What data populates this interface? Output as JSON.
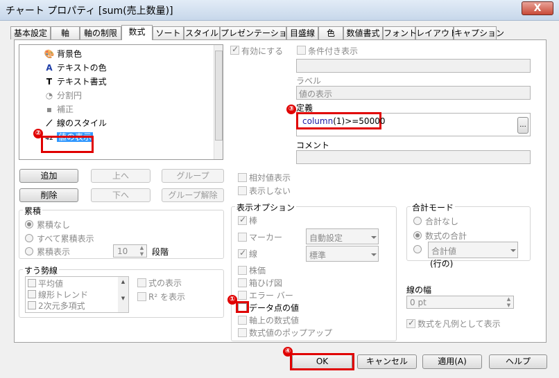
{
  "window": {
    "title": "チャート プロパティ [sum(売上数量)]",
    "close": "X"
  },
  "tabs": [
    "基本設定",
    "軸",
    "軸の制限",
    "数式",
    "ソート",
    "スタイル",
    "プレゼンテーション",
    "目盛線",
    "色",
    "数値書式",
    "フォント",
    "レイアウト",
    "キャプション"
  ],
  "active_tab": "数式",
  "expression_list": [
    {
      "label": "背景色",
      "icon": "palette-icon"
    },
    {
      "label": "テキストの色",
      "icon": "text-color-icon"
    },
    {
      "label": "テキスト書式",
      "icon": "text-format-icon"
    },
    {
      "label": "分割円",
      "icon": "pie-icon"
    },
    {
      "label": "補正",
      "icon": "adjust-icon"
    },
    {
      "label": "線のスタイル",
      "icon": "line-style-icon"
    },
    {
      "label": "値の表示",
      "icon": "value-display-icon"
    }
  ],
  "list_buttons": {
    "add": "追加",
    "up": "上へ",
    "group": "グループ",
    "delete": "削除",
    "down": "下へ",
    "ungroup": "グループ解除"
  },
  "accumulation": {
    "legend": "累積",
    "none": "累積なし",
    "all": "すべて累積表示",
    "show": "累積表示",
    "steps_value": "10",
    "steps_label": "段階"
  },
  "trendlines": {
    "legend": "すう勢線",
    "items": [
      "平均値",
      "線形トレンド",
      "2次元多項式"
    ],
    "show_equation": "式の表示",
    "show_r2": "R² を表示"
  },
  "enable": "有効にする",
  "conditional": "条件付き表示",
  "label": {
    "caption": "ラベル",
    "value": "値の表示"
  },
  "definition": {
    "caption": "定義",
    "fn": "column",
    "arg": "(1)",
    "rest": ">=50000",
    "browse": "..."
  },
  "comment": {
    "caption": "コメント"
  },
  "relative": "相対値表示",
  "invisible": "表示しない",
  "display_options": {
    "legend": "表示オプション",
    "bar": "棒",
    "marker": "マーカー",
    "marker_value": "自動設定",
    "line": "線",
    "line_value": "標準",
    "stock": "株価",
    "box": "箱ひげ図",
    "error": "エラー バー",
    "values_on_data": "データ点の値",
    "text_on_axis": "軸上の数式値",
    "popup": "数式値のポップアップ"
  },
  "total_mode": {
    "legend": "合計モード",
    "none": "合計なし",
    "sum": "数式の合計",
    "total_value": "合計値",
    "rows": "(行の)"
  },
  "line_width": {
    "caption": "線の幅",
    "value": "0 pt"
  },
  "show_in_legend": "数式を凡例として表示",
  "footer": {
    "ok": "OK",
    "cancel": "キャンセル",
    "apply": "適用(A)",
    "help": "ヘルプ"
  },
  "annotations": [
    "①",
    "②",
    "③",
    "④"
  ],
  "colors": {
    "annotation_red": "#e00000",
    "selection_blue": "#3399ff"
  }
}
